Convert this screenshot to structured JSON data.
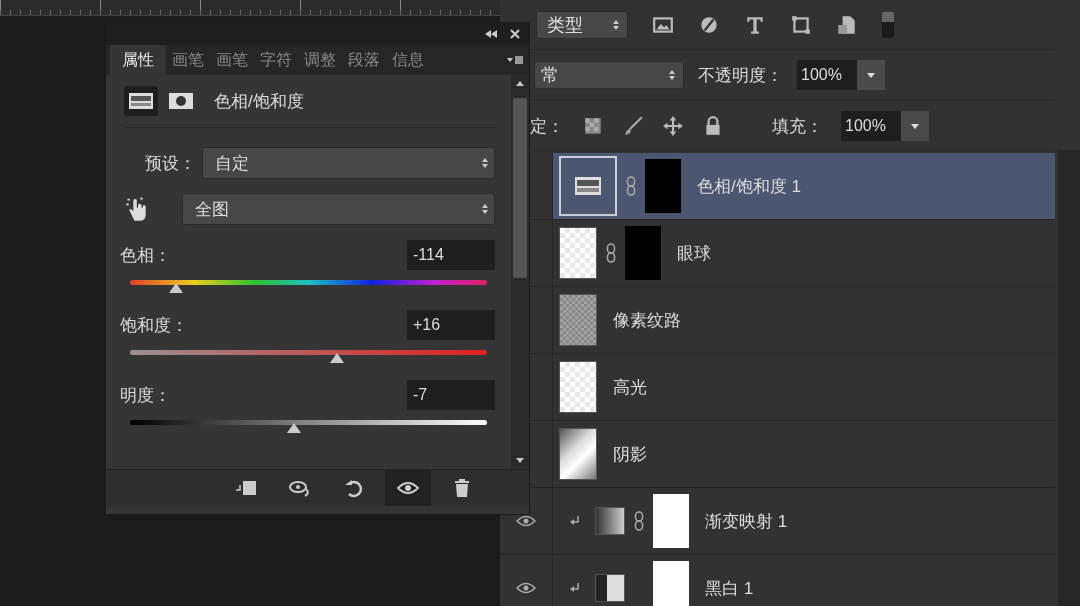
{
  "properties_panel": {
    "tabs": [
      {
        "label": "属性",
        "selected": true
      },
      {
        "label": "画笔",
        "selected": false
      },
      {
        "label": "画笔",
        "selected": false
      },
      {
        "label": "字符",
        "selected": false
      },
      {
        "label": "调整",
        "selected": false
      },
      {
        "label": "段落",
        "selected": false
      },
      {
        "label": "信息",
        "selected": false
      }
    ],
    "mode_buttons": [
      {
        "kind": "adjustment",
        "selected": true
      },
      {
        "kind": "mask",
        "selected": false
      }
    ],
    "adjustment_title": "色相/饱和度",
    "preset": {
      "label": "预设：",
      "value": "自定"
    },
    "channel": {
      "value": "全图"
    },
    "sliders": [
      {
        "kind": "hue",
        "label": "色相：",
        "value": "-114",
        "level": 0.13
      },
      {
        "kind": "saturation",
        "label": "饱和度：",
        "value": "+16",
        "level": 0.58
      },
      {
        "kind": "lightness",
        "label": "明度：",
        "value": "-7",
        "level": 0.46
      }
    ],
    "footer_buttons": [
      {
        "kind": "clip",
        "selected": false
      },
      {
        "kind": "previous",
        "selected": false
      },
      {
        "kind": "reset",
        "selected": false
      },
      {
        "kind": "visibility",
        "selected": true
      },
      {
        "kind": "delete",
        "selected": false
      }
    ]
  },
  "layers_panel": {
    "filter": {
      "value": "类型"
    },
    "filter_icons": [
      {
        "kind": "image"
      },
      {
        "kind": "adjustment"
      },
      {
        "kind": "type"
      },
      {
        "kind": "shape"
      },
      {
        "kind": "smart"
      }
    ],
    "blend_mode": {
      "value": "常"
    },
    "opacity": {
      "label": "不透明度：",
      "value": "100%"
    },
    "lock": {
      "label": "定："
    },
    "lock_icons": [
      {
        "kind": "pixels"
      },
      {
        "kind": "paint"
      },
      {
        "kind": "move"
      },
      {
        "kind": "all"
      }
    ],
    "fill": {
      "label": "填充：",
      "value": "100%"
    },
    "layers": [
      {
        "name": "色相/饱和度 1",
        "kind": "adjustment",
        "mask": {
          "color": "#000000"
        },
        "linked": true,
        "clipped": false,
        "selected": true
      },
      {
        "name": "眼球",
        "kind": "transparent",
        "mask": {
          "color": "#000000"
        },
        "linked": true,
        "clipped": false,
        "selected": false
      },
      {
        "name": "像素纹路",
        "kind": "noise",
        "linked": false,
        "clipped": false,
        "selected": false
      },
      {
        "name": "高光",
        "kind": "transparent",
        "linked": false,
        "clipped": false,
        "selected": false
      },
      {
        "name": "阴影",
        "kind": "shadow",
        "linked": false,
        "clipped": false,
        "selected": false
      },
      {
        "name": "渐变映射 1",
        "kind": "gradient",
        "mask": {
          "color": "#ffffff"
        },
        "linked": true,
        "clipped": true,
        "visible": true,
        "selected": false
      },
      {
        "name": "黑白 1",
        "kind": "bw",
        "mask": {
          "color": "#ffffff"
        },
        "linked": false,
        "clipped": true,
        "visible": true,
        "selected": false
      }
    ]
  }
}
